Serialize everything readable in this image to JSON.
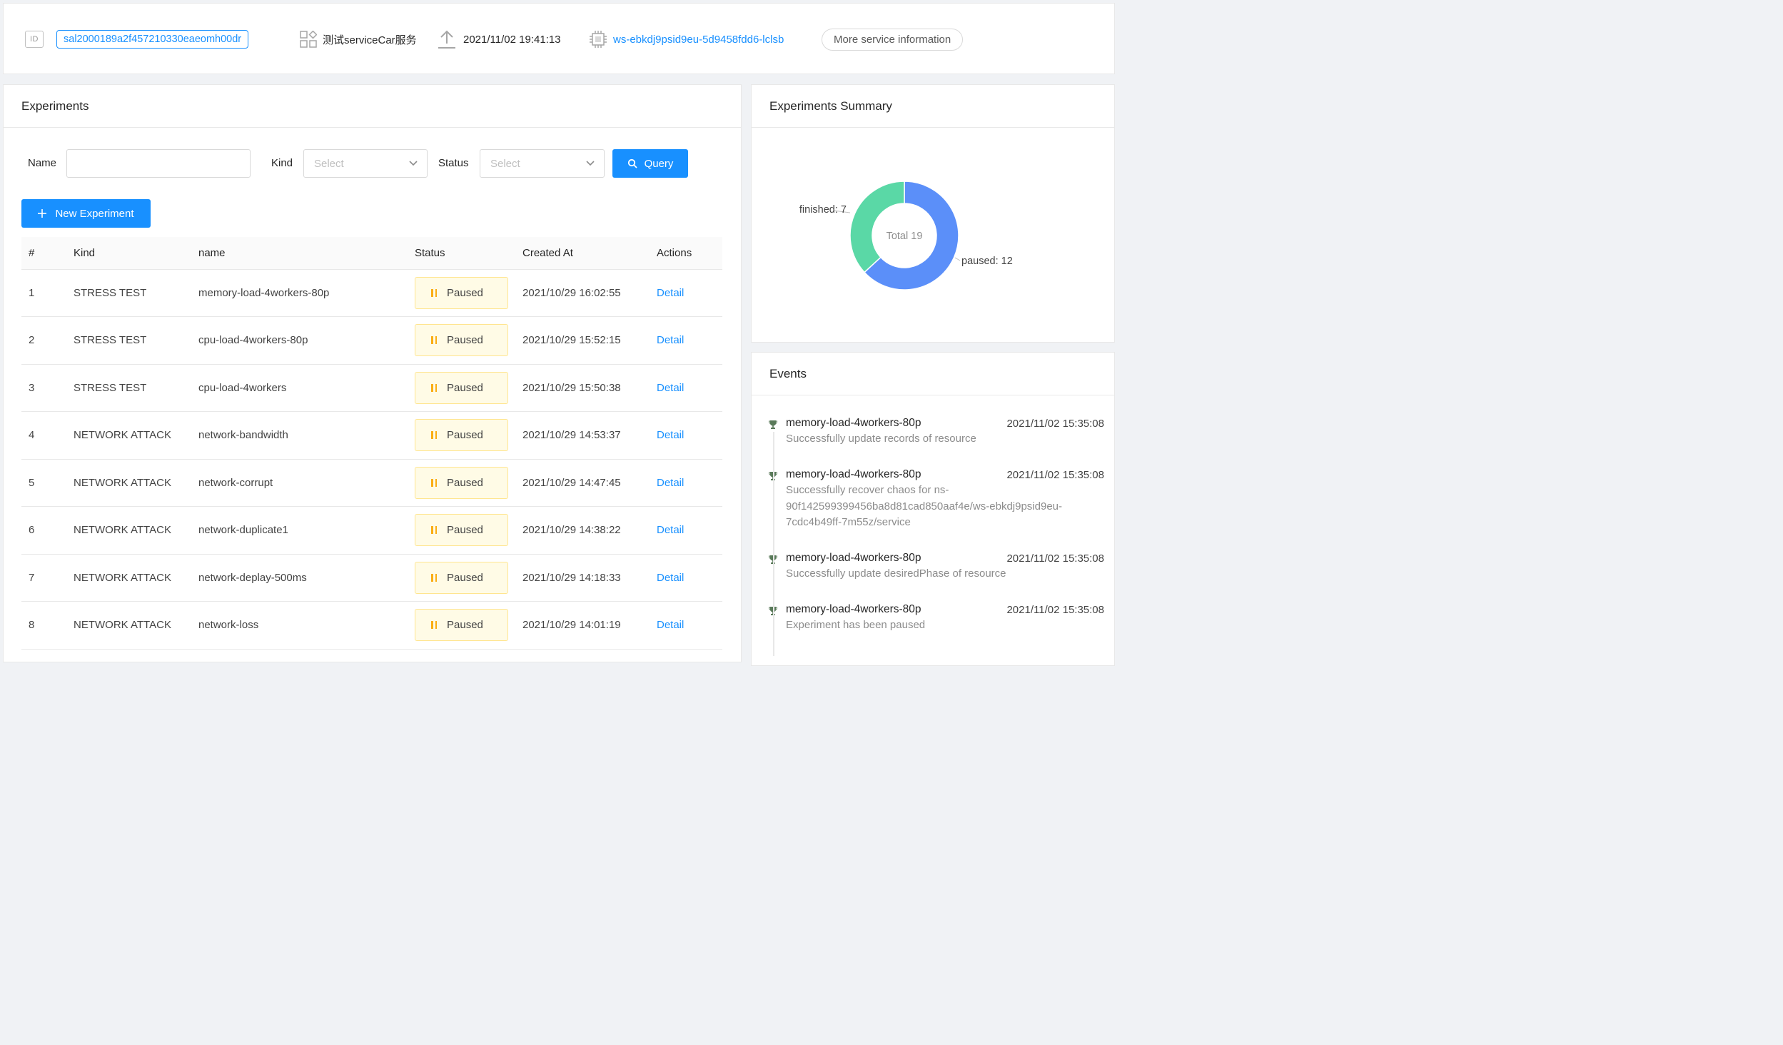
{
  "topbar": {
    "id_badge": "ID",
    "id": "sal2000189a2f457210330eaeomh00dr",
    "service_name": "测试serviceCar服务",
    "created": "2021/11/02 19:41:13",
    "workspace": "ws-ebkdj9psid9eu-5d9458fdd6-lclsb",
    "more_btn": "More service information"
  },
  "experiments": {
    "title": "Experiments",
    "name_label": "Name",
    "name_value": "",
    "kind_label": "Kind",
    "kind_placeholder": "Select",
    "status_label": "Status",
    "status_placeholder": "Select",
    "query_btn": "Query",
    "new_btn": "New Experiment",
    "columns": [
      "#",
      "Kind",
      "name",
      "Status",
      "Created At",
      "Actions"
    ],
    "rows": [
      {
        "n": "1",
        "kind": "STRESS TEST",
        "name": "memory-load-4workers-80p",
        "status": "Paused",
        "created": "2021/10/29 16:02:55",
        "action": "Detail"
      },
      {
        "n": "2",
        "kind": "STRESS TEST",
        "name": "cpu-load-4workers-80p",
        "status": "Paused",
        "created": "2021/10/29 15:52:15",
        "action": "Detail"
      },
      {
        "n": "3",
        "kind": "STRESS TEST",
        "name": "cpu-load-4workers",
        "status": "Paused",
        "created": "2021/10/29 15:50:38",
        "action": "Detail"
      },
      {
        "n": "4",
        "kind": "NETWORK ATTACK",
        "name": "network-bandwidth",
        "status": "Paused",
        "created": "2021/10/29 14:53:37",
        "action": "Detail"
      },
      {
        "n": "5",
        "kind": "NETWORK ATTACK",
        "name": "network-corrupt",
        "status": "Paused",
        "created": "2021/10/29 14:47:45",
        "action": "Detail"
      },
      {
        "n": "6",
        "kind": "NETWORK ATTACK",
        "name": "network-duplicate1",
        "status": "Paused",
        "created": "2021/10/29 14:38:22",
        "action": "Detail"
      },
      {
        "n": "7",
        "kind": "NETWORK ATTACK",
        "name": "network-deplay-500ms",
        "status": "Paused",
        "created": "2021/10/29 14:18:33",
        "action": "Detail"
      },
      {
        "n": "8",
        "kind": "NETWORK ATTACK",
        "name": "network-loss",
        "status": "Paused",
        "created": "2021/10/29 14:01:19",
        "action": "Detail"
      }
    ]
  },
  "summary": {
    "title": "Experiments Summary",
    "center_label": "Total 19",
    "slices": [
      {
        "label": "finished: 7",
        "value": 7,
        "color": "#5ad8a6"
      },
      {
        "label": "paused: 12",
        "value": 12,
        "color": "#5b8ff9"
      }
    ]
  },
  "events": {
    "title": "Events",
    "items": [
      {
        "title": "memory-load-4workers-80p",
        "time": "2021/11/02 15:35:08",
        "desc_lines": [
          "Successfully update records of resource"
        ]
      },
      {
        "title": "memory-load-4workers-80p",
        "time": "2021/11/02 15:35:08",
        "desc_lines": [
          "Successfully recover chaos for ns-",
          "90f142599399456ba8d81cad850aaf4e/ws-ebkdj9psid9eu-",
          "7cdc4b49ff-7m55z/service"
        ]
      },
      {
        "title": "memory-load-4workers-80p",
        "time": "2021/11/02 15:35:08",
        "desc_lines": [
          "Successfully update desiredPhase of resource"
        ]
      },
      {
        "title": "memory-load-4workers-80p",
        "time": "2021/11/02 15:35:08",
        "desc_lines": [
          "Experiment has been paused"
        ]
      }
    ]
  },
  "colors": {
    "primary": "#1890ff",
    "paused_bg": "#fffbe6",
    "paused_border": "#ffe58f",
    "paused_icon": "#faad14"
  }
}
